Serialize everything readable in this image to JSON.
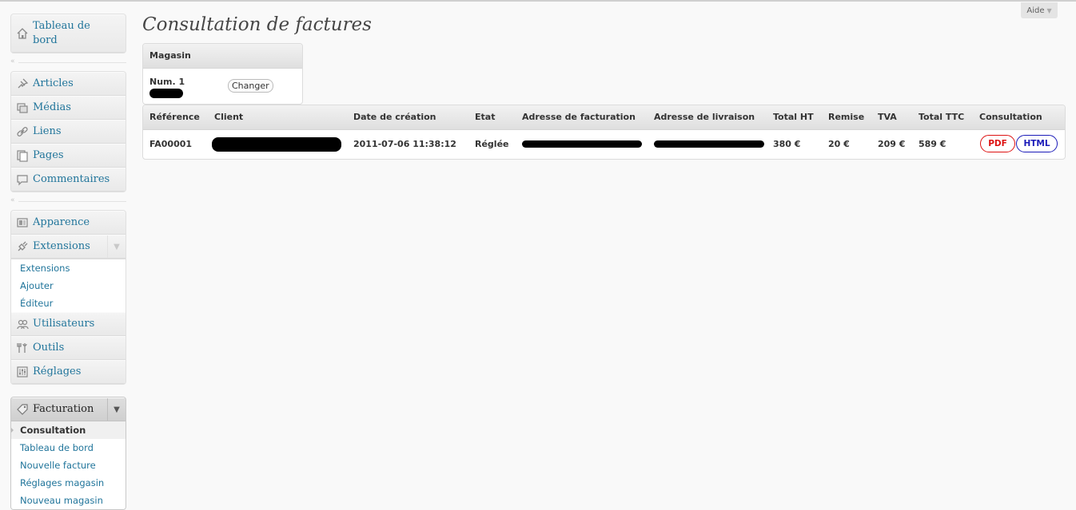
{
  "help": {
    "label": "Aide"
  },
  "page": {
    "title": "Consultation de factures"
  },
  "sidebar": {
    "dashboard": "Tableau de bord",
    "group1": [
      "Articles",
      "Médias",
      "Liens",
      "Pages",
      "Commentaires"
    ],
    "group2": [
      "Apparence",
      "Extensions"
    ],
    "extensions_sub": [
      "Extensions",
      "Ajouter",
      "Éditeur"
    ],
    "group3": [
      "Utilisateurs",
      "Outils",
      "Réglages"
    ],
    "facturation": {
      "label": "Facturation",
      "items": [
        "Consultation",
        "Tableau de bord",
        "Nouvelle facture",
        "Réglages magasin",
        "Nouveau magasin"
      ]
    }
  },
  "store_box": {
    "title": "Magasin",
    "store_label": "Num. 1",
    "change_button": "Changer"
  },
  "invoice_table": {
    "headers": [
      "Référence",
      "Client",
      "Date de création",
      "Etat",
      "Adresse de facturation",
      "Adresse de livraison",
      "Total HT",
      "Remise",
      "TVA",
      "Total TTC",
      "Consultation"
    ],
    "rows": [
      {
        "reference": "FA00001",
        "date": "2011-07-06 11:38:12",
        "status": "Réglée",
        "total_ht": "380 €",
        "discount": "20 €",
        "vat": "209 €",
        "total_ttc": "589 €",
        "pdf_label": "PDF",
        "html_label": "HTML"
      }
    ]
  }
}
